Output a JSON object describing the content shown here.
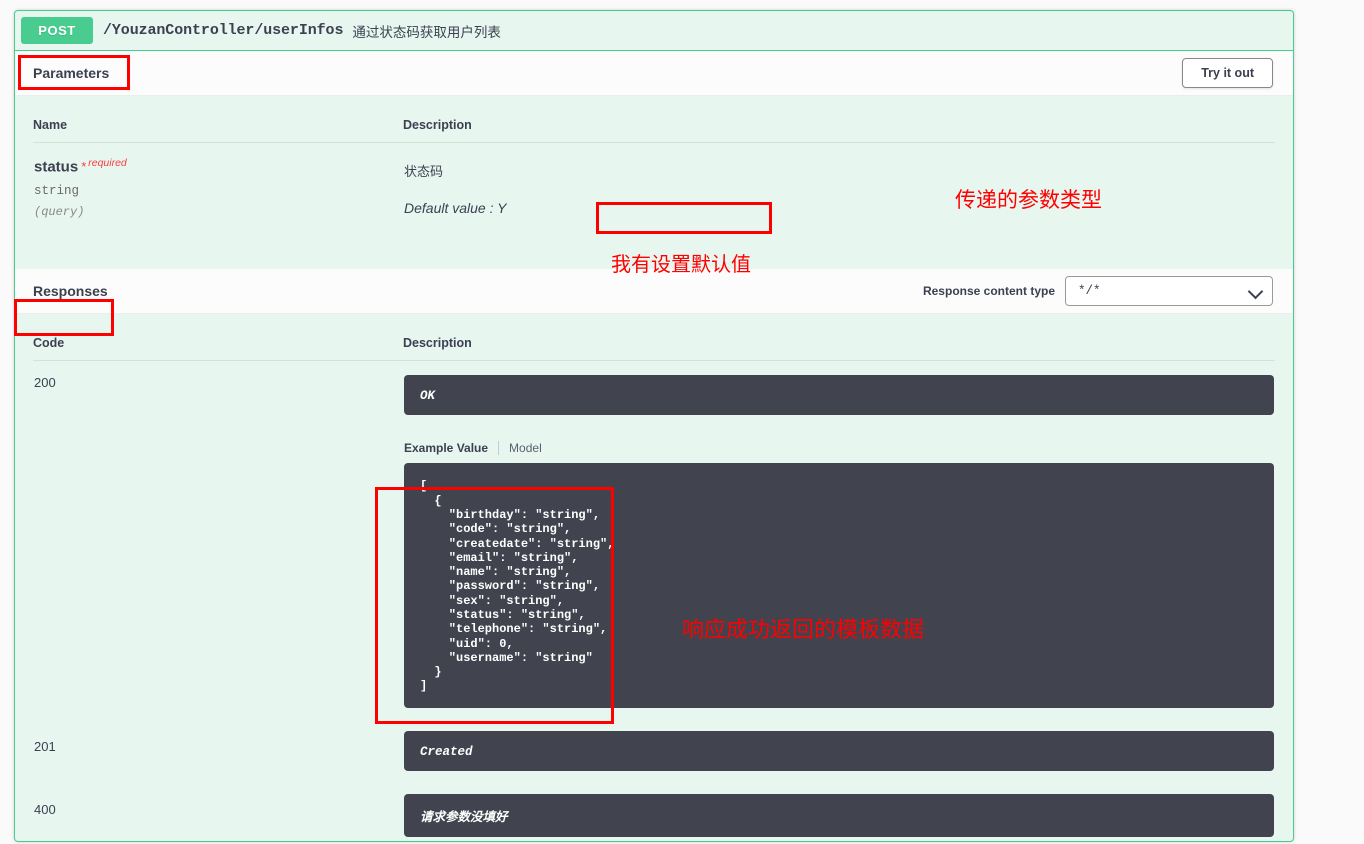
{
  "operation": {
    "method": "POST",
    "path": "/YouzanController/userInfos",
    "summary": "通过状态码获取用户列表"
  },
  "parameters": {
    "section_title": "Parameters",
    "try_it_out_label": "Try it out",
    "columns": {
      "name": "Name",
      "description": "Description"
    },
    "rows": [
      {
        "name": "status",
        "required_star": "*",
        "required_text": "required",
        "type": "string",
        "in": "(query)",
        "description": "状态码",
        "default_value": "Default value : Y"
      }
    ]
  },
  "responses": {
    "section_title": "Responses",
    "content_type_label": "Response content type",
    "content_type_value": "*/*",
    "columns": {
      "code": "Code",
      "description": "Description"
    },
    "example_tabs": {
      "example_value": "Example Value",
      "model": "Model"
    },
    "rows": [
      {
        "code": "200",
        "message": "OK",
        "example_json": "[\n  {\n    \"birthday\": \"string\",\n    \"code\": \"string\",\n    \"createdate\": \"string\",\n    \"email\": \"string\",\n    \"name\": \"string\",\n    \"password\": \"string\",\n    \"sex\": \"string\",\n    \"status\": \"string\",\n    \"telephone\": \"string\",\n    \"uid\": 0,\n    \"username\": \"string\"\n  }\n]"
      },
      {
        "code": "201",
        "message": "Created"
      },
      {
        "code": "400",
        "message": "请求参数没填好"
      }
    ]
  },
  "annotations": [
    {
      "id": "param-type-note",
      "text": "传递的参数类型"
    },
    {
      "id": "default-value-note",
      "text": "我有设置默认值"
    },
    {
      "id": "response-template-note",
      "text": "响应成功返回的模板数据"
    }
  ],
  "colors": {
    "method_post": "#49cc90",
    "block_bg": "#e8f6f0",
    "dark_block": "#41444e",
    "annotation_red": "#ff0000",
    "required_red": "#f93e3e"
  }
}
